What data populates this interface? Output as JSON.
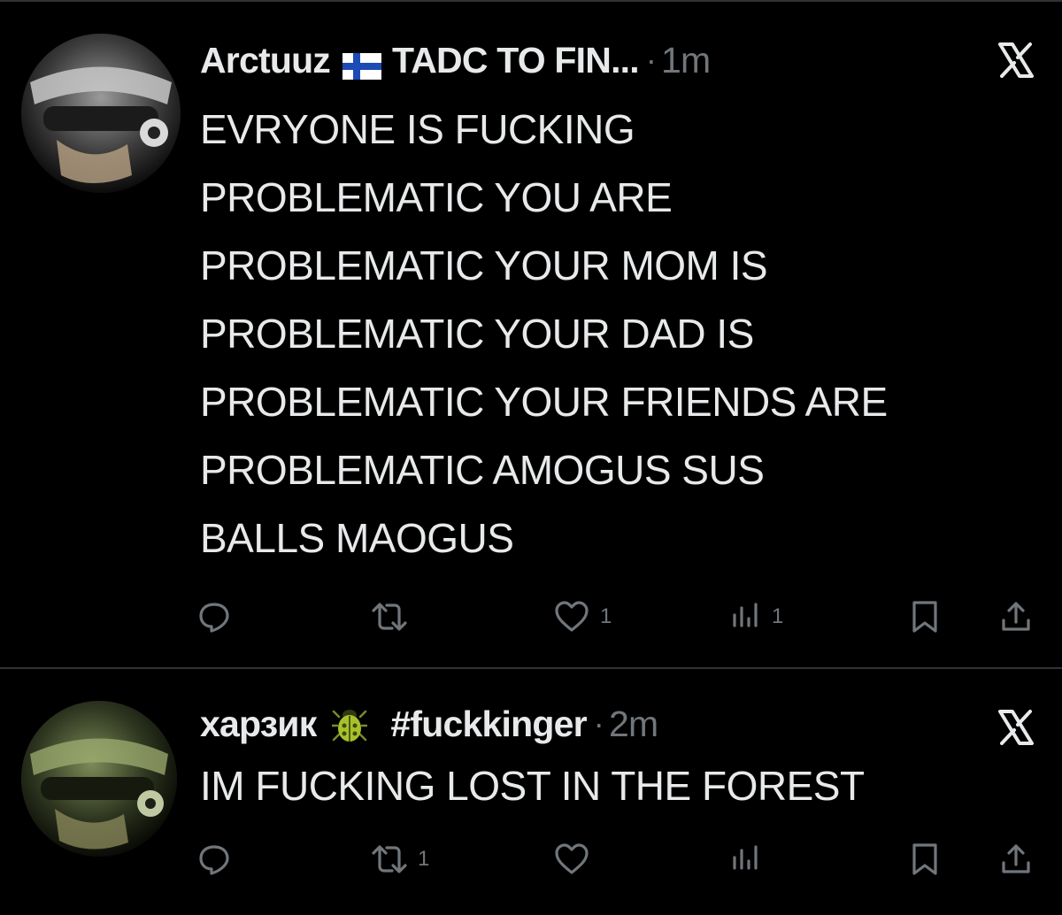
{
  "posts": [
    {
      "display_name": "Arctuuz",
      "name_suffix": "TADC TO FIN...",
      "separator": "·",
      "time": "1m",
      "text": "EVRYONE IS FUCKING\nPROBLEMATIC YOU ARE\nPROBLEMATIC YOUR MOM IS\nPROBLEMATIC YOUR DAD IS\nPROBLEMATIC YOUR FRIENDS ARE\nPROBLEMATIC AMOGUS SUS\nBALLS MAOGUS",
      "reply_count": "",
      "repost_count": "",
      "like_count": "1",
      "views_count": "1",
      "emoji": "finland-flag-icon"
    },
    {
      "display_name": "харзик",
      "name_suffix": "#fuckkinger",
      "separator": "·",
      "time": "2m",
      "text": "IM FUCKING LOST IN THE FOREST",
      "reply_count": "",
      "repost_count": "1",
      "like_count": "",
      "views_count": "",
      "emoji": "beetle-icon"
    }
  ],
  "colors": {
    "background": "#000000",
    "text": "#e7e9ea",
    "muted": "#71767b",
    "divider": "#2f3336"
  },
  "icons": [
    "reply-icon",
    "repost-icon",
    "like-icon",
    "views-icon",
    "bookmark-icon",
    "share-icon",
    "x-logo-icon"
  ]
}
